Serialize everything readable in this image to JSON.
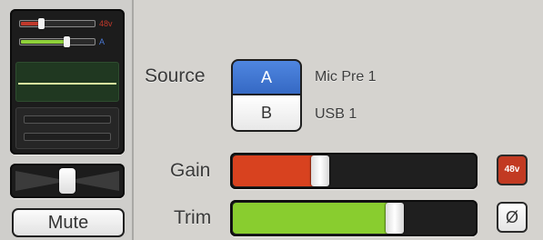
{
  "channel_strip": {
    "mini_rows": [
      {
        "label": "48v",
        "label_color": "#c0392b",
        "fill_color": "#c0392b",
        "level": 0.28
      },
      {
        "label": "A",
        "label_color": "#4a78d6",
        "fill_color": "#8fd13a",
        "level": 0.62
      }
    ],
    "pan_level": 0.5,
    "mute_label": "Mute"
  },
  "input": {
    "source_label": "Source",
    "options": [
      {
        "key": "A",
        "name": "Mic Pre 1",
        "selected": true
      },
      {
        "key": "B",
        "name": "USB 1",
        "selected": false
      }
    ]
  },
  "gain": {
    "label": "Gain",
    "level": 0.36,
    "fill_color": "#d8421f",
    "phantom_label": "48v",
    "phantom_on": true
  },
  "trim": {
    "label": "Trim",
    "level": 0.67,
    "fill_color": "#89cd2f",
    "phase_label": "Ø"
  },
  "colors": {
    "accent_blue": "#3d74d4",
    "phantom_red": "#c23a22",
    "trim_green": "#89cd2f"
  }
}
